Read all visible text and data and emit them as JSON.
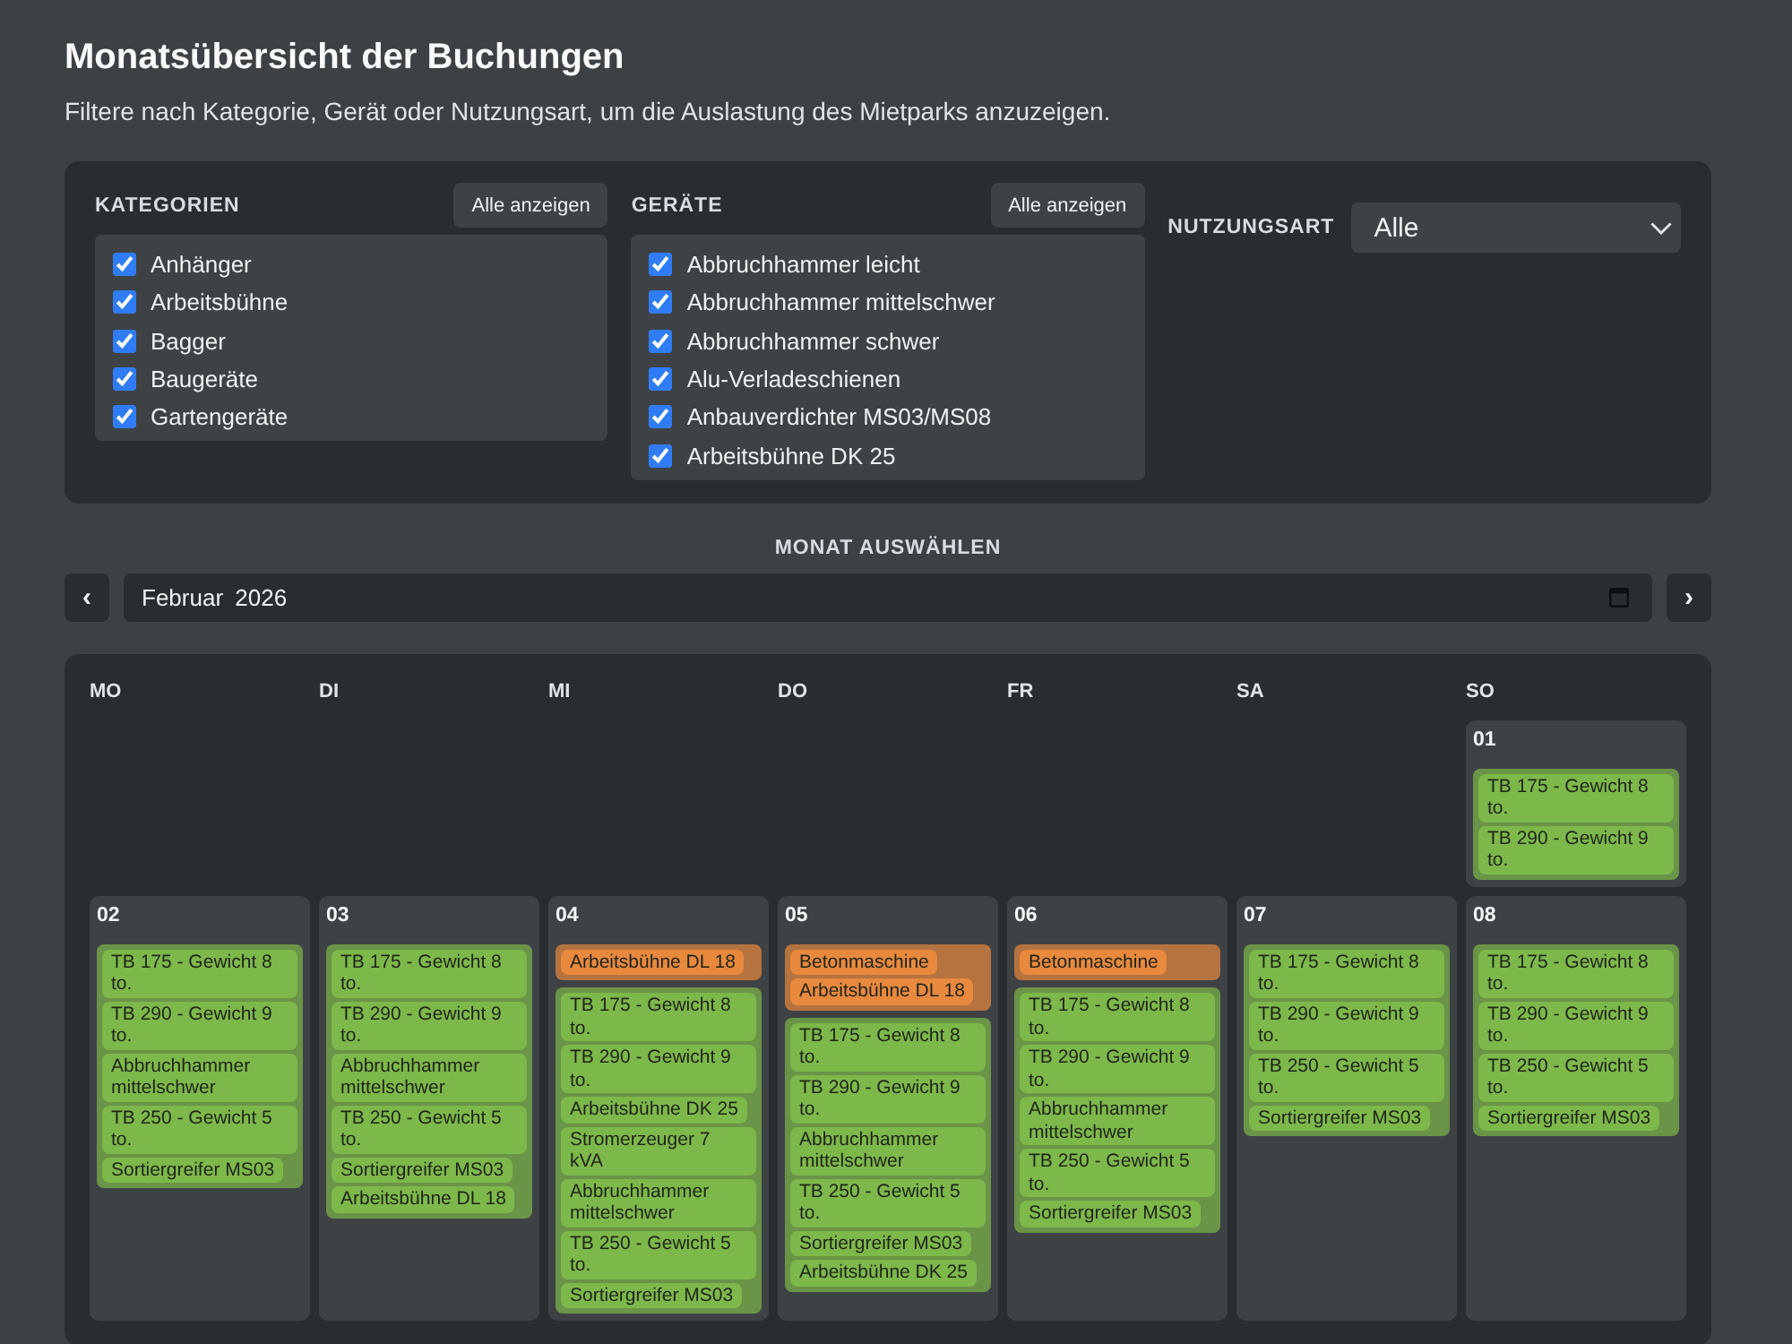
{
  "header": {
    "title": "Monatsübersicht der Buchungen",
    "subtitle": "Filtere nach Kategorie, Gerät oder Nutzungsart, um die Auslastung des Mietparks anzuzeigen."
  },
  "filters": {
    "categories": {
      "label": "KATEGORIEN",
      "button": "Alle anzeigen",
      "items": [
        {
          "label": "Anhänger",
          "checked": true
        },
        {
          "label": "Arbeitsbühne",
          "checked": true
        },
        {
          "label": "Bagger",
          "checked": true
        },
        {
          "label": "Baugeräte",
          "checked": true
        },
        {
          "label": "Gartengeräte",
          "checked": true
        }
      ]
    },
    "devices": {
      "label": "GERÄTE",
      "button": "Alle anzeigen",
      "items": [
        {
          "label": "Abbruchhammer leicht",
          "checked": true
        },
        {
          "label": "Abbruchhammer mittelschwer",
          "checked": true
        },
        {
          "label": "Abbruchhammer schwer",
          "checked": true
        },
        {
          "label": "Alu-Verladeschienen",
          "checked": true
        },
        {
          "label": "Anbauverdichter MS03/MS08",
          "checked": true
        },
        {
          "label": "Arbeitsbühne DK 25",
          "checked": true
        }
      ]
    },
    "usage": {
      "label": "NUTZUNGSART",
      "value": "Alle"
    }
  },
  "month_picker": {
    "label": "MONAT AUSWÄHLEN",
    "prev": "‹",
    "value": "Februar 2026",
    "next": "›"
  },
  "calendar": {
    "weekdays": [
      "MO",
      "DI",
      "MI",
      "DO",
      "FR",
      "SA",
      "SO"
    ],
    "weeks": [
      {
        "kind": "leading",
        "days": [
          {
            "day": "01",
            "groups": [
              {
                "color": "#7db84a",
                "items": [
                  "TB 175 - Gewicht 8 to.",
                  "TB 290 - Gewicht 9 to."
                ]
              }
            ]
          }
        ]
      },
      {
        "kind": "full",
        "days": [
          {
            "day": "02",
            "groups": [
              {
                "color": "#7db84a",
                "items": [
                  "TB 175 - Gewicht 8 to.",
                  "TB 290 - Gewicht 9 to.",
                  "Abbruchhammer mittelschwer",
                  "TB 250 - Gewicht 5 to.",
                  "Sortiergreifer MS03"
                ]
              }
            ]
          },
          {
            "day": "03",
            "groups": [
              {
                "color": "#7db84a",
                "items": [
                  "TB 175 - Gewicht 8 to.",
                  "TB 290 - Gewicht 9 to.",
                  "Abbruchhammer mittelschwer",
                  "TB 250 - Gewicht 5 to.",
                  "Sortiergreifer MS03",
                  "Arbeitsbühne DL 18"
                ]
              }
            ]
          },
          {
            "day": "04",
            "groups": [
              {
                "color": "#e8893d",
                "items": [
                  "Arbeitsbühne DL 18"
                ]
              },
              {
                "color": "#7db84a",
                "items": [
                  "TB 175 - Gewicht 8 to.",
                  "TB 290 - Gewicht 9 to.",
                  "Arbeitsbühne DK 25",
                  "Stromerzeuger 7 kVA",
                  "Abbruchhammer mittelschwer",
                  "TB 250 - Gewicht 5 to.",
                  "Sortiergreifer MS03"
                ]
              }
            ]
          },
          {
            "day": "05",
            "groups": [
              {
                "color": "#e8893d",
                "items": [
                  "Betonmaschine",
                  "Arbeitsbühne DL 18"
                ]
              },
              {
                "color": "#7db84a",
                "items": [
                  "TB 175 - Gewicht 8 to.",
                  "TB 290 - Gewicht 9 to.",
                  "Abbruchhammer mittelschwer",
                  "TB 250 - Gewicht 5 to.",
                  "Sortiergreifer MS03",
                  "Arbeitsbühne DK 25"
                ]
              }
            ]
          },
          {
            "day": "06",
            "groups": [
              {
                "color": "#e8893d",
                "items": [
                  "Betonmaschine"
                ]
              },
              {
                "color": "#7db84a",
                "items": [
                  "TB 175 - Gewicht 8 to.",
                  "TB 290 - Gewicht 9 to.",
                  "Abbruchhammer mittelschwer",
                  "TB 250 - Gewicht 5 to.",
                  "Sortiergreifer MS03"
                ]
              }
            ]
          },
          {
            "day": "07",
            "groups": [
              {
                "color": "#7db84a",
                "items": [
                  "TB 175 - Gewicht 8 to.",
                  "TB 290 - Gewicht 9 to.",
                  "TB 250 - Gewicht 5 to.",
                  "Sortiergreifer MS03"
                ]
              }
            ]
          },
          {
            "day": "08",
            "groups": [
              {
                "color": "#7db84a",
                "items": [
                  "TB 175 - Gewicht 8 to.",
                  "TB 290 - Gewicht 9 to.",
                  "TB 250 - Gewicht 5 to.",
                  "Sortiergreifer MS03"
                ]
              }
            ]
          }
        ]
      }
    ]
  }
}
